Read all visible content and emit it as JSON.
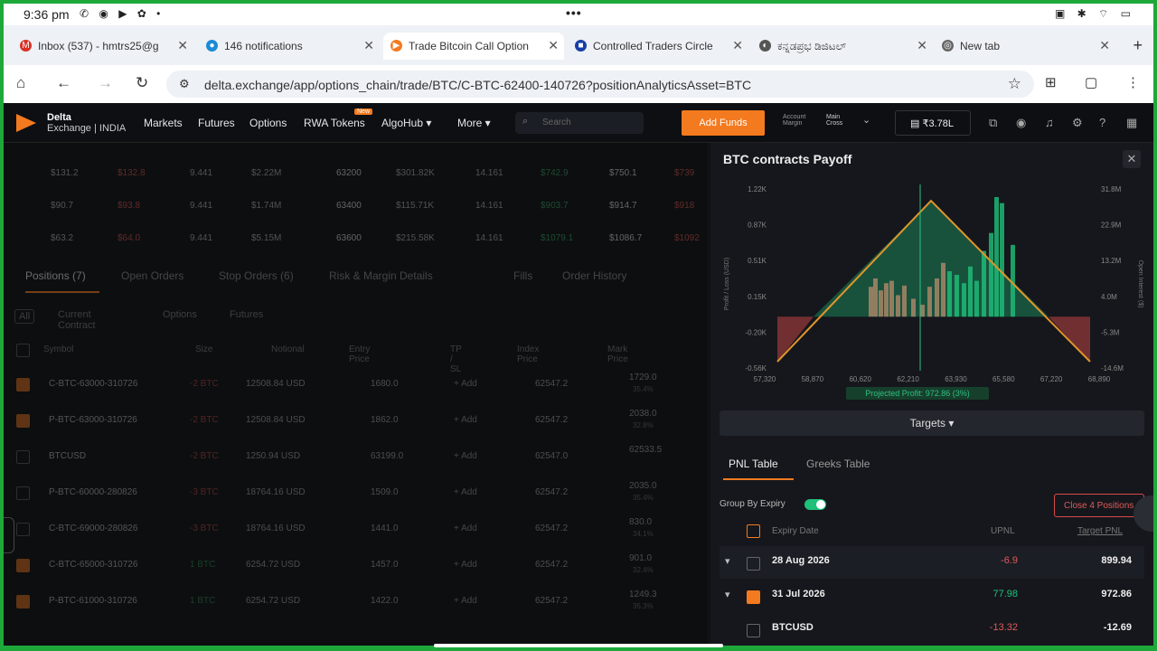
{
  "status_bar": {
    "time": "9:36 pm",
    "dots": "•••"
  },
  "browser": {
    "tabs": [
      {
        "label": "Inbox (537) - hmtrs25@g",
        "icon": "gmail-icon",
        "color": "#d93025"
      },
      {
        "label": "146 notifications",
        "icon": "notification-icon",
        "color": "#1a8cd8"
      },
      {
        "label": "Trade Bitcoin Call Option",
        "icon": "delta-icon",
        "color": "#f47a1f"
      },
      {
        "label": "Controlled Traders Circle",
        "icon": "app-icon",
        "color": "#1a3ea8"
      },
      {
        "label": "ಕನ್ನಡಪ್ರಭ ಡಿಜಿಟಲ್",
        "icon": "site-icon",
        "color": "#555"
      },
      {
        "label": "New tab",
        "icon": "chrome-icon",
        "color": "#666"
      }
    ],
    "url": "delta.exchange/app/options_chain/trade/BTC/C-BTC-62400-140726?positionAnalyticsAsset=BTC"
  },
  "nav": {
    "logo_line1": "Delta",
    "logo_line2": "Exchange | INDIA",
    "items": [
      "Markets",
      "Futures",
      "Options",
      "RWA Tokens",
      "AlgoHub ▾",
      "More ▾"
    ],
    "new_badge": "New",
    "search_placeholder": "Search",
    "add_funds": "Add Funds",
    "account_label": "Account Margin",
    "account_value": "Main Cross",
    "balance": "₹3.78L"
  },
  "chain_rows": [
    {
      "a": "$131.2",
      "b": "$132.8",
      "c": "9.441",
      "d": "$2.22M",
      "strike": "63200",
      "e": "$301.82K",
      "f": "14.161",
      "g": "$742.9",
      "h": "$750.1",
      "i": "$739"
    },
    {
      "a": "$90.7",
      "b": "$93.8",
      "c": "9.441",
      "d": "$1.74M",
      "strike": "63400",
      "e": "$115.71K",
      "f": "14.161",
      "g": "$903.7",
      "h": "$914.7",
      "i": "$918"
    },
    {
      "a": "$63.2",
      "b": "$64.0",
      "c": "9.441",
      "d": "$5.15M",
      "strike": "63600",
      "e": "$215.58K",
      "f": "14.161",
      "g": "$1079.1",
      "h": "$1086.7",
      "i": "$1092"
    }
  ],
  "positions": {
    "tabs": [
      "Positions (7)",
      "Open Orders",
      "Stop Orders (6)",
      "Risk & Margin Details",
      "Fills",
      "Order History"
    ],
    "filters": [
      "All",
      "Current Contract",
      "Options",
      "Futures"
    ],
    "headers": [
      "Symbol",
      "Size",
      "Notional",
      "Entry Price",
      "TP / SL",
      "Index Price",
      "Mark Price"
    ],
    "rows": [
      {
        "sym": "C-BTC-63000-310726",
        "size": "-2 BTC",
        "notional": "12508.84 USD",
        "entry": "1680.0",
        "tpsl": "+ Add",
        "index": "62547.2",
        "mark": "1729.0",
        "mark2": "35.4%",
        "checked": true
      },
      {
        "sym": "P-BTC-63000-310726",
        "size": "-2 BTC",
        "notional": "12508.84 USD",
        "entry": "1862.0",
        "tpsl": "+ Add",
        "index": "62547.2",
        "mark": "2038.0",
        "mark2": "32.8%",
        "checked": true
      },
      {
        "sym": "BTCUSD",
        "size": "-2 BTC",
        "notional": "1250.94 USD",
        "entry": "63199.0",
        "tpsl": "+ Add",
        "index": "62547.0",
        "mark": "62533.5",
        "mark2": "",
        "checked": false
      },
      {
        "sym": "P-BTC-60000-280826",
        "size": "-3 BTC",
        "notional": "18764.16 USD",
        "entry": "1509.0",
        "tpsl": "+ Add",
        "index": "62547.2",
        "mark": "2035.0",
        "mark2": "35.4%",
        "checked": false
      },
      {
        "sym": "C-BTC-69000-280826",
        "size": "-3 BTC",
        "notional": "18764.16 USD",
        "entry": "1441.0",
        "tpsl": "+ Add",
        "index": "62547.2",
        "mark": "830.0",
        "mark2": "34.1%",
        "checked": false
      },
      {
        "sym": "C-BTC-65000-310726",
        "size": "1 BTC",
        "notional": "6254.72 USD",
        "entry": "1457.0",
        "tpsl": "+ Add",
        "index": "62547.2",
        "mark": "901.0",
        "mark2": "32.4%",
        "checked": true
      },
      {
        "sym": "P-BTC-61000-310726",
        "size": "1 BTC",
        "notional": "6254.72 USD",
        "entry": "1422.0",
        "tpsl": "+ Add",
        "index": "62547.2",
        "mark": "1249.3",
        "mark2": "35.3%",
        "checked": true
      }
    ]
  },
  "payoff": {
    "title": "BTC contracts Payoff",
    "close": "✕",
    "y_left": [
      "1.22K",
      "0.87K",
      "0.51K",
      "0.15K",
      "-0.20K",
      "-0.56K"
    ],
    "y_right": [
      "31.8M",
      "22.9M",
      "13.2M",
      "4.0M",
      "-5.3M",
      "-14.6M"
    ],
    "x_ticks": [
      "57,320",
      "58,870",
      "60,620",
      "62,210",
      "63,930",
      "65,580",
      "67,220",
      "68,890"
    ],
    "y_left_label": "Profit / Loss (USD)",
    "y_right_label": "Open Interest ($)",
    "projected": "Projected Profit: 972.86 (3%)",
    "targets": "Targets ▾",
    "colors": {
      "profit": "#1fc07a",
      "loss": "#b04040",
      "line": "#e0952a"
    }
  },
  "pnl": {
    "tabs": [
      "PNL Table",
      "Greeks Table"
    ],
    "group_label": "Group By Expiry",
    "close_btn": "Close 4 Positions",
    "headers": [
      "Expiry Date",
      "UPNL",
      "Target PNL"
    ],
    "rows": [
      {
        "arrow": "▾",
        "label": "28 Aug 2026",
        "upnl": "-6.9",
        "target": "899.94",
        "upnl_color": "#e05a5a",
        "checked": false
      },
      {
        "arrow": "▾",
        "label": "31 Jul 2026",
        "upnl": "77.98",
        "target": "972.86",
        "upnl_color": "#1fc07a",
        "checked": true
      },
      {
        "arrow": "",
        "label": "BTCUSD",
        "upnl": "-13.32",
        "target": "-12.69",
        "upnl_color": "#e05a5a",
        "checked": false
      }
    ]
  }
}
